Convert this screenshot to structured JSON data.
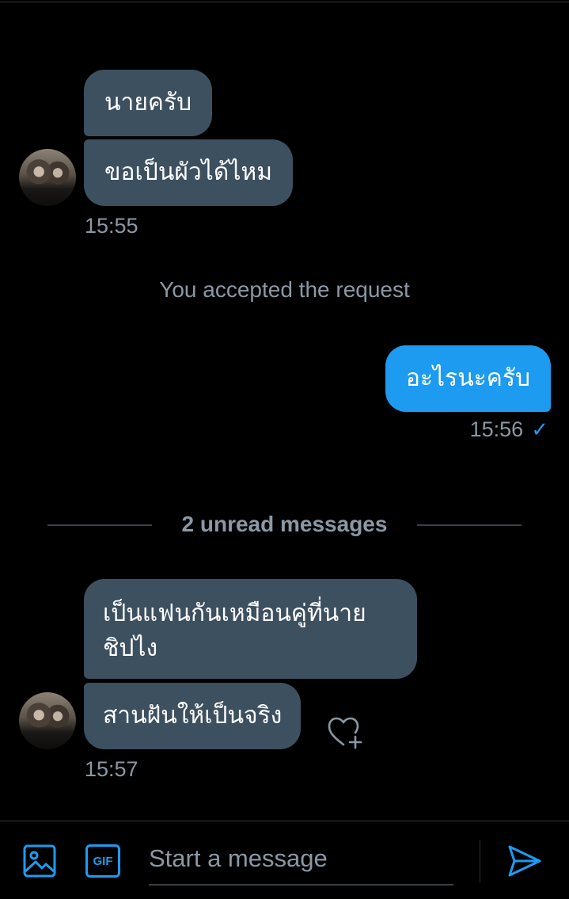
{
  "conversation": {
    "group1": {
      "messages": [
        "นายครับ",
        "ขอเป็นผัวได้ไหม"
      ],
      "time": "15:55"
    },
    "system_note": "You accepted the request",
    "outgoing": {
      "message": "อะไรนะครับ",
      "time": "15:56",
      "status_icon": "check-icon"
    },
    "unread_label": "2 unread messages",
    "group2": {
      "messages": [
        "เป็นแฟนกันเหมือนคู่ที่นาย",
        "ชิปไง",
        "สานฝันให้เป็นจริง"
      ],
      "time": "15:57"
    }
  },
  "composer": {
    "placeholder": "Start a message",
    "media_icon": "image-icon",
    "gif_label": "GIF",
    "send_icon": "send-icon"
  },
  "colors": {
    "background": "#000000",
    "incoming_bubble": "#3d5060",
    "outgoing_bubble": "#1d9bf0",
    "accent": "#1d9bf0",
    "muted_text": "#8b98a5"
  }
}
